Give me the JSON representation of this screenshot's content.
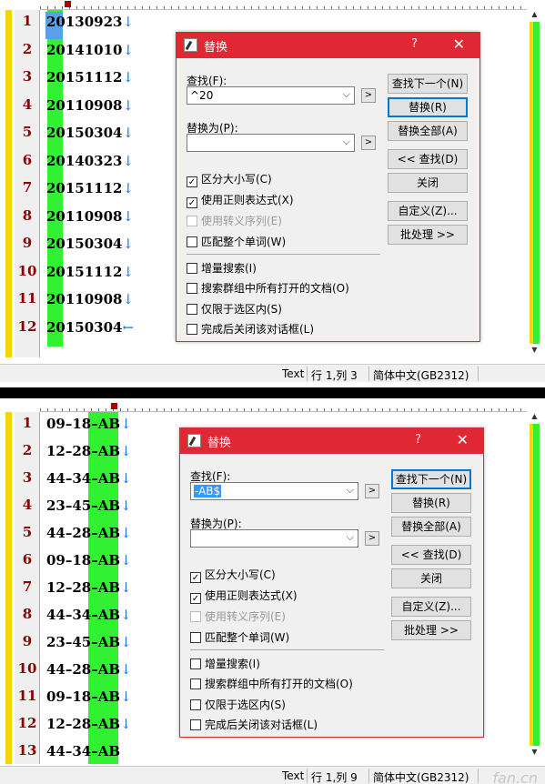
{
  "top": {
    "lines": [
      {
        "num": "1",
        "text": "20130923"
      },
      {
        "num": "2",
        "text": "20141010"
      },
      {
        "num": "3",
        "text": "20151112"
      },
      {
        "num": "4",
        "text": "20110908"
      },
      {
        "num": "5",
        "text": "20150304"
      },
      {
        "num": "6",
        "text": "20140323"
      },
      {
        "num": "7",
        "text": "20151112"
      },
      {
        "num": "8",
        "text": "20110908"
      },
      {
        "num": "9",
        "text": "20150304"
      },
      {
        "num": "10",
        "text": "20151112"
      },
      {
        "num": "11",
        "text": "20110908"
      },
      {
        "num": "12",
        "text": "20150304"
      }
    ],
    "eol": "↓",
    "last_eol": "←",
    "status": {
      "mode": "Text",
      "position": "行 1,列 3",
      "encoding": "简体中文(GB2312)"
    },
    "dialog": {
      "title": "替换",
      "help": "?",
      "find_label": "查找(F):",
      "find_value": "^20",
      "replace_label": "替换为(P):",
      "replace_value": "",
      "buttons": [
        "查找下一个(N)",
        "替换(R)",
        "替换全部(A)",
        "<< 查找(D)",
        "关闭",
        "自定义(Z)...",
        "批处理 >>"
      ],
      "checkboxes": [
        {
          "label": "区分大小写(C)",
          "checked": "✓"
        },
        {
          "label": "使用正则表达式(X)",
          "checked": "✓"
        },
        {
          "label": "使用转义序列(E)",
          "checked": ""
        },
        {
          "label": "匹配整个单词(W)",
          "checked": ""
        },
        {
          "label": "增量搜索(I)",
          "checked": ""
        },
        {
          "label": "搜索群组中所有打开的文档(O)",
          "checked": ""
        },
        {
          "label": "仅限于选区内(S)",
          "checked": ""
        },
        {
          "label": "完成后关闭该对话框(L)",
          "checked": ""
        }
      ]
    }
  },
  "bottom": {
    "lines": [
      {
        "num": "1",
        "text": "09–18–AB"
      },
      {
        "num": "2",
        "text": "12–28–AB"
      },
      {
        "num": "3",
        "text": "44–34–AB"
      },
      {
        "num": "4",
        "text": "23–45–AB"
      },
      {
        "num": "5",
        "text": "44–28–AB"
      },
      {
        "num": "6",
        "text": "09–18–AB"
      },
      {
        "num": "7",
        "text": "12–28–AB"
      },
      {
        "num": "8",
        "text": "44–34–AB"
      },
      {
        "num": "9",
        "text": "23–45–AB"
      },
      {
        "num": "10",
        "text": "44–28–AB"
      },
      {
        "num": "11",
        "text": "09–18–AB"
      },
      {
        "num": "12",
        "text": "12–28–AB"
      },
      {
        "num": "13",
        "text": "44–34–AB"
      }
    ],
    "eol": "↓",
    "status": {
      "mode": "Text",
      "position": "行 1,列 9",
      "encoding": "简体中文(GB2312)"
    },
    "dialog": {
      "title": "替换",
      "help": "?",
      "find_label": "查找(F):",
      "find_value": "-AB$",
      "replace_label": "替换为(P):",
      "replace_value": "",
      "buttons": [
        "查找下一个(N)",
        "替换(R)",
        "替换全部(A)",
        "<< 查找(D)",
        "关闭",
        "自定义(Z)...",
        "批处理 >>"
      ],
      "checkboxes": [
        {
          "label": "区分大小写(C)",
          "checked": "✓"
        },
        {
          "label": "使用正则表达式(X)",
          "checked": "✓"
        },
        {
          "label": "使用转义序列(E)",
          "checked": ""
        },
        {
          "label": "匹配整个单词(W)",
          "checked": ""
        },
        {
          "label": "增量搜索(I)",
          "checked": ""
        },
        {
          "label": "搜索群组中所有打开的文档(O)",
          "checked": ""
        },
        {
          "label": "仅限于选区内(S)",
          "checked": ""
        },
        {
          "label": "完成后关闭该对话框(L)",
          "checked": ""
        }
      ]
    },
    "watermark": "fan.cn"
  },
  "colors": {
    "titlebar": "#e02734",
    "highlight_green": "#32f032",
    "gutter_bar": "#f7d600",
    "selection": "#57a1e6",
    "line_number": "#8b0000"
  }
}
